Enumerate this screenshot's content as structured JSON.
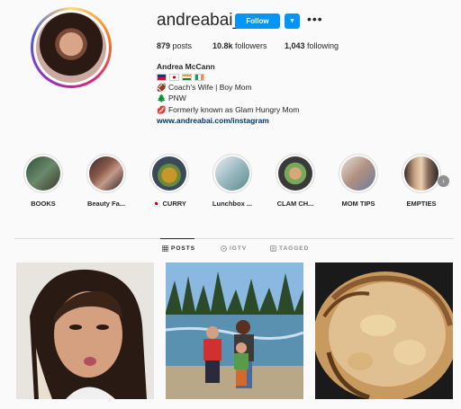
{
  "profile": {
    "username": "andreabai__",
    "follow_label": "Follow",
    "more_label": "•••",
    "dropdown_label": "▼"
  },
  "stats": {
    "posts_count": "879",
    "posts_label": "posts",
    "followers_count": "10.8k",
    "followers_label": "followers",
    "following_count": "1,043",
    "following_label": "following"
  },
  "bio": {
    "name": "Andrea McCann",
    "line1": "Coach's Wife | Boy Mom",
    "line2": "PNW",
    "line3": "Formerly known as Glam Hungry Mom",
    "link": "www.andreabai.com/instagram",
    "flags": [
      "philippines",
      "japan",
      "india",
      "ireland"
    ]
  },
  "highlights": [
    {
      "label": "BOOKS",
      "icon": "books-highlight"
    },
    {
      "label": "Beauty Fa...",
      "icon": "beauty-highlight"
    },
    {
      "label": "🇯🇵 CURRY",
      "icon": "curry-highlight"
    },
    {
      "label": "Lunchbox ...",
      "icon": "lunchbox-highlight"
    },
    {
      "label": "CLAM CH...",
      "icon": "clam-highlight"
    },
    {
      "label": "MOM TIPS",
      "icon": "momtips-highlight"
    },
    {
      "label": "EMPTIES",
      "icon": "empties-highlight"
    }
  ],
  "tabs": [
    {
      "label": "POSTS",
      "icon": "grid-icon",
      "active": true
    },
    {
      "label": "IGTV",
      "icon": "igtv-icon",
      "active": false
    },
    {
      "label": "TAGGED",
      "icon": "tag-icon",
      "active": false
    }
  ],
  "colors": {
    "accent": "#0095f6",
    "text": "#262626",
    "muted": "#8e8e8e",
    "link": "#00376b"
  }
}
